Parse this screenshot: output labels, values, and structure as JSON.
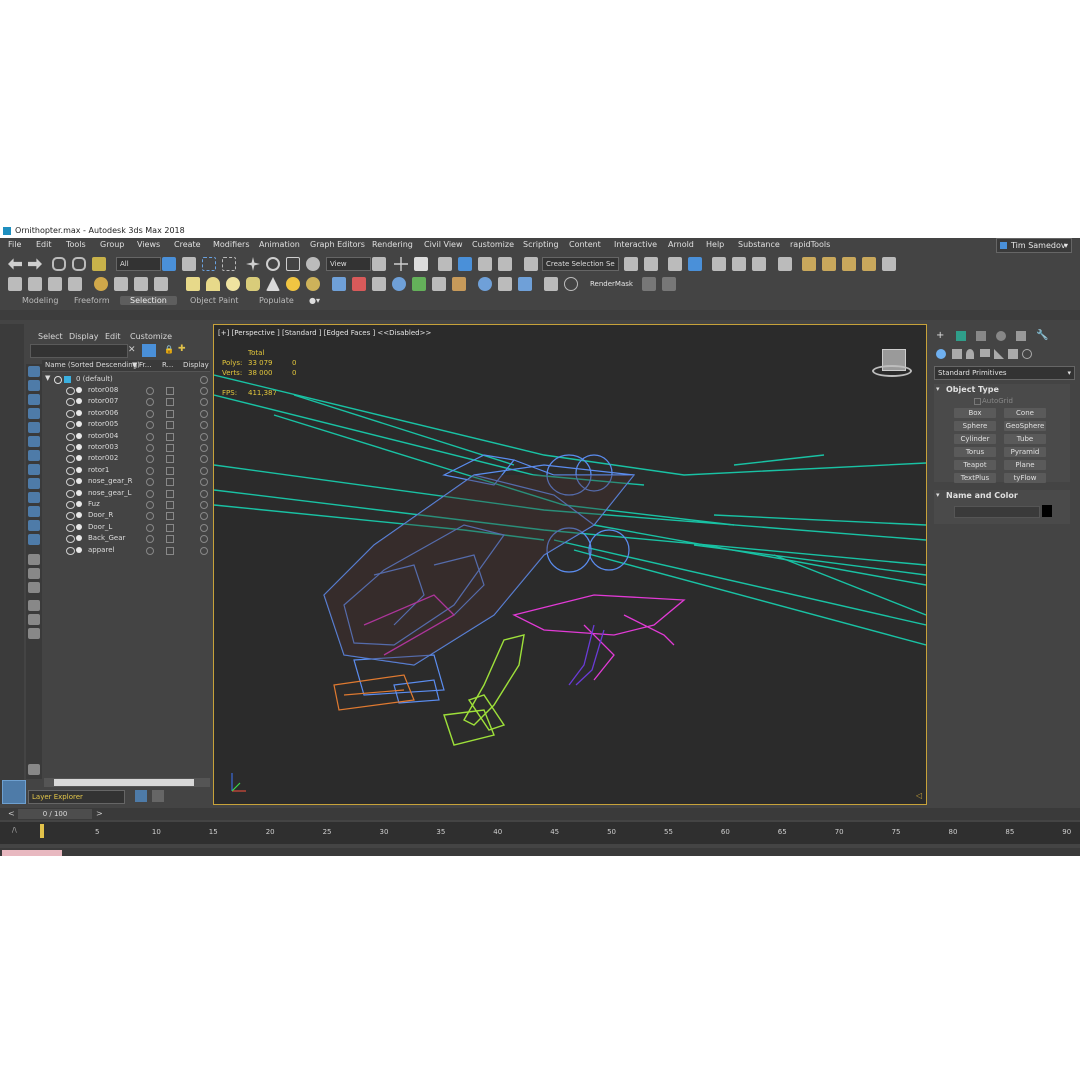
{
  "window": {
    "title": "Ornithopter.max - Autodesk 3ds Max 2018"
  },
  "menu": [
    "File",
    "Edit",
    "Tools",
    "Group",
    "Views",
    "Create",
    "Modifiers",
    "Animation",
    "Graph Editors",
    "Rendering",
    "Civil View",
    "Customize",
    "Scripting",
    "Content",
    "Interactive",
    "Arnold",
    "Help",
    "Substance",
    "rapidTools"
  ],
  "user": {
    "name": "Tim Samedov"
  },
  "toolbar": {
    "filter_value": "All",
    "refcoord_value": "View",
    "selection_set": "Create Selection Se",
    "render_mask": "RenderMask"
  },
  "ribbon_tabs": [
    "Modeling",
    "Freeform",
    "Selection",
    "Object Paint",
    "Populate"
  ],
  "explorer": {
    "menu": [
      "Select",
      "Display",
      "Edit",
      "Customize"
    ],
    "col_name": "Name (Sorted Descending)",
    "col_fr": "Fr...",
    "col_r": "R...",
    "col_display": "Display a",
    "root": "0 (default)",
    "items": [
      "rotor008",
      "rotor007",
      "rotor006",
      "rotor005",
      "rotor004",
      "rotor003",
      "rotor002",
      "rotor1",
      "nose_gear_R",
      "nose_gear_L",
      "Fuz",
      "Door_R",
      "Door_L",
      "Back_Gear",
      "apparel"
    ],
    "bottom_label": "Layer Explorer"
  },
  "viewport": {
    "label": "[+] [Perspective ] [Standard ] [Edged Faces ]  <<Disabled>>",
    "stats": {
      "total_label": "Total",
      "polys_label": "Polys:",
      "polys_value": "33 079",
      "polys_sel": "0",
      "verts_label": "Verts:",
      "verts_value": "38 000",
      "verts_sel": "0",
      "fps_label": "FPS:",
      "fps_value": "411,387"
    }
  },
  "command_panel": {
    "category": "Standard Primitives",
    "object_type_label": "Object Type",
    "autogrid_label": "AutoGrid",
    "buttons": [
      "Box",
      "Cone",
      "Sphere",
      "GeoSphere",
      "Cylinder",
      "Tube",
      "Torus",
      "Pyramid",
      "Teapot",
      "Plane",
      "TextPlus",
      "tyFlow"
    ],
    "name_color_label": "Name and Color",
    "swatch_color": "#000000"
  },
  "timeline": {
    "frame_display": "0 / 100",
    "ticks": [
      "5",
      "10",
      "15",
      "20",
      "25",
      "30",
      "35",
      "40",
      "45",
      "50",
      "55",
      "60",
      "65",
      "70",
      "75",
      "80",
      "85",
      "90"
    ]
  },
  "colors": {
    "accent_teal": "#19c2a4",
    "wire_blue": "#5b8df0",
    "wire_magenta": "#e23ad6",
    "wire_green": "#9ee03a",
    "wire_orange": "#e07a30",
    "viewport_border": "#c7a23a"
  }
}
